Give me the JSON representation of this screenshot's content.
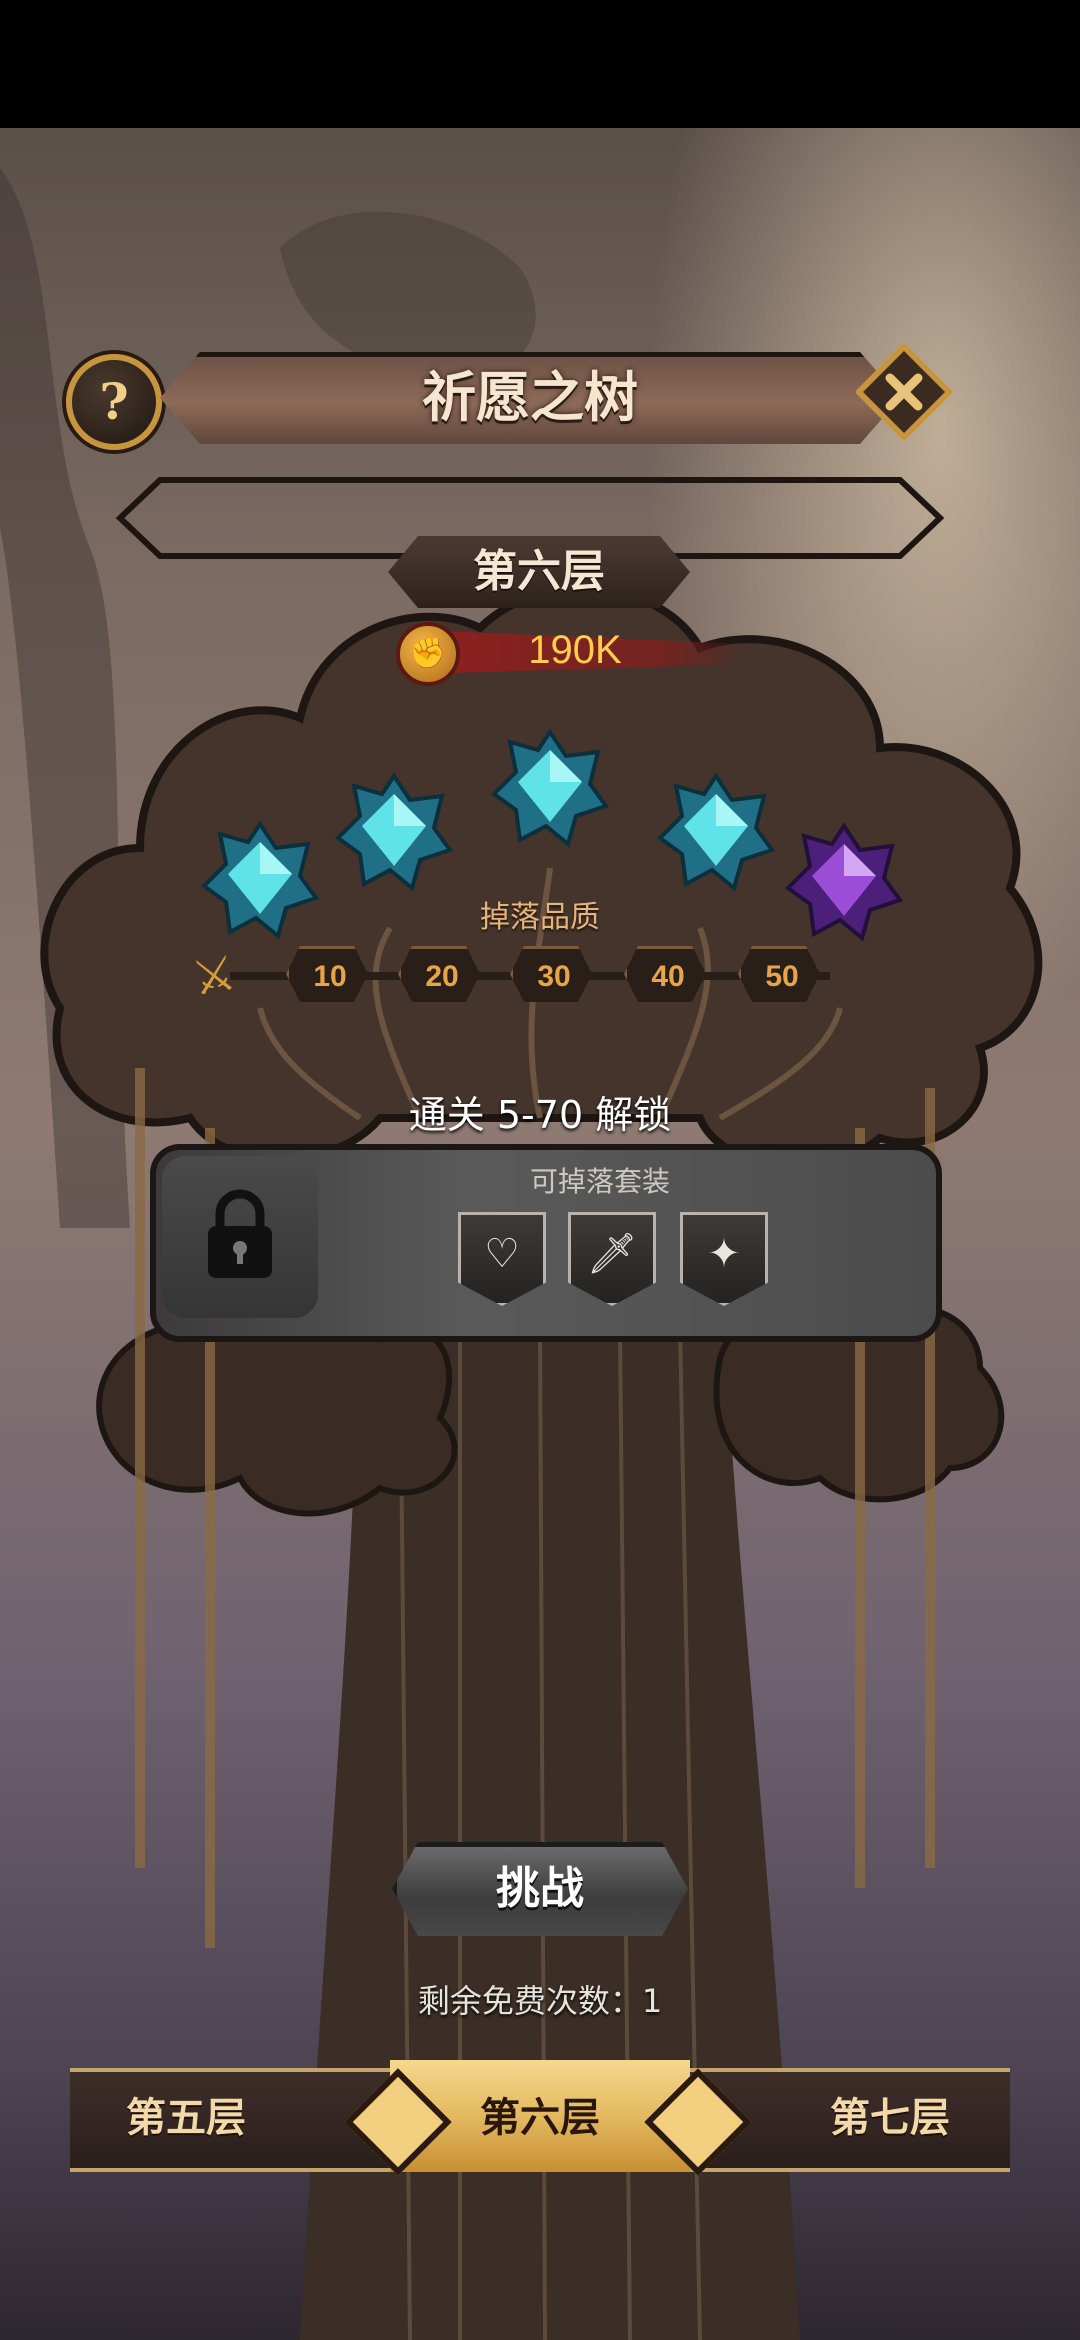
{
  "header": {
    "help_label": "?",
    "title": "祈愿之树"
  },
  "floor": {
    "name": "第六层",
    "power": "190K"
  },
  "drop_quality": {
    "label": "掉落品质",
    "levels": [
      "10",
      "20",
      "30",
      "40",
      "50"
    ],
    "gems": [
      "cyan",
      "cyan",
      "cyan",
      "cyan",
      "purple"
    ]
  },
  "unlock_text": "通关 5-70 解锁",
  "set_panel": {
    "title": "可掉落套装",
    "slots": [
      "heart-shield-icon",
      "sword-shield-icon",
      "star-shield-icon"
    ]
  },
  "challenge": {
    "button_label": "挑战",
    "free_attempts": "剩余免费次数：1"
  },
  "floor_nav": {
    "prev": "第五层",
    "current": "第六层",
    "next": "第七层"
  },
  "colors": {
    "gem_cyan": "#5fe3e8",
    "gem_purple": "#9b4dd8",
    "gold": "#c8953f",
    "power_text": "#ffcf4a"
  }
}
